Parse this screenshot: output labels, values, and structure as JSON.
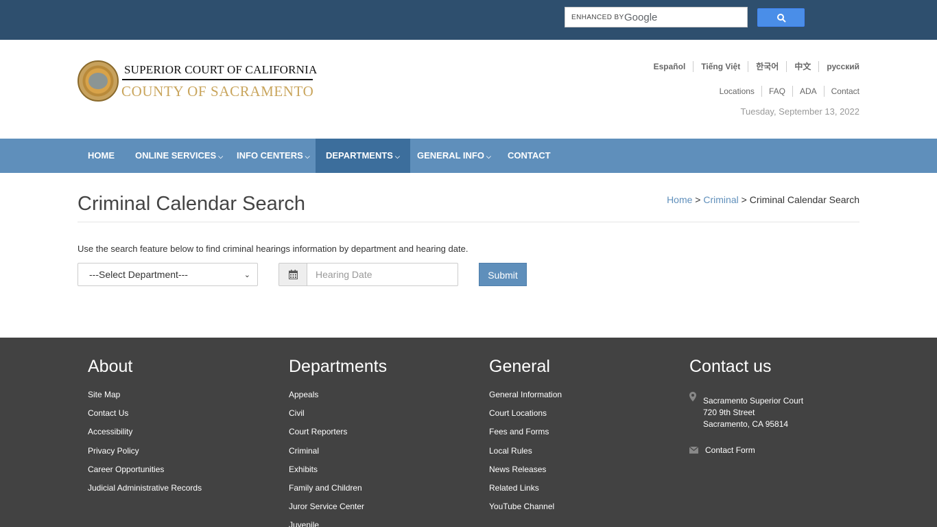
{
  "search": {
    "enhanced_by": "ENHANCED BY",
    "google": "Google"
  },
  "header": {
    "title_line1": "SUPERIOR COURT OF CALIFORNIA",
    "title_line2": "COUNTY OF SACRAMENTO",
    "languages": [
      "Español",
      "Tiếng Việt",
      "한국어",
      "中文",
      "русский"
    ],
    "utility_links": [
      "Locations",
      "FAQ",
      "ADA",
      "Contact"
    ],
    "date": "Tuesday, September 13, 2022"
  },
  "nav": {
    "items": [
      {
        "label": "HOME"
      },
      {
        "label": "ONLINE SERVICES"
      },
      {
        "label": "INFO CENTERS"
      },
      {
        "label": "DEPARTMENTS"
      },
      {
        "label": "GENERAL INFO"
      },
      {
        "label": "CONTACT"
      }
    ]
  },
  "page": {
    "title": "Criminal Calendar Search",
    "breadcrumb": {
      "home": "Home",
      "sep1": " > ",
      "criminal": "Criminal",
      "sep2": " > ",
      "current": "Criminal Calendar Search"
    },
    "intro": "Use the search feature below to find criminal hearings information by department and hearing date.",
    "department_select": "---Select Department---",
    "hearing_date_placeholder": "Hearing Date",
    "submit_label": "Submit"
  },
  "footer": {
    "about": {
      "heading": "About",
      "links": [
        "Site Map",
        "Contact Us",
        "Accessibility",
        "Privacy Policy",
        "Career Opportunities",
        "Judicial Administrative Records"
      ]
    },
    "departments": {
      "heading": "Departments",
      "links": [
        "Appeals",
        "Civil",
        "Court Reporters",
        "Criminal",
        "Exhibits",
        "Family and Children",
        "Juror Service Center",
        "Juvenile"
      ]
    },
    "general": {
      "heading": "General",
      "links": [
        "General Information",
        "Court Locations",
        "Fees and Forms",
        "Local Rules",
        "News Releases",
        "Related Links",
        "YouTube Channel"
      ]
    },
    "contact": {
      "heading": "Contact us",
      "address_line1": "Sacramento Superior Court",
      "address_line2": "720 9th Street",
      "address_line3": "Sacramento, CA 95814",
      "contact_form": "Contact Form"
    }
  }
}
